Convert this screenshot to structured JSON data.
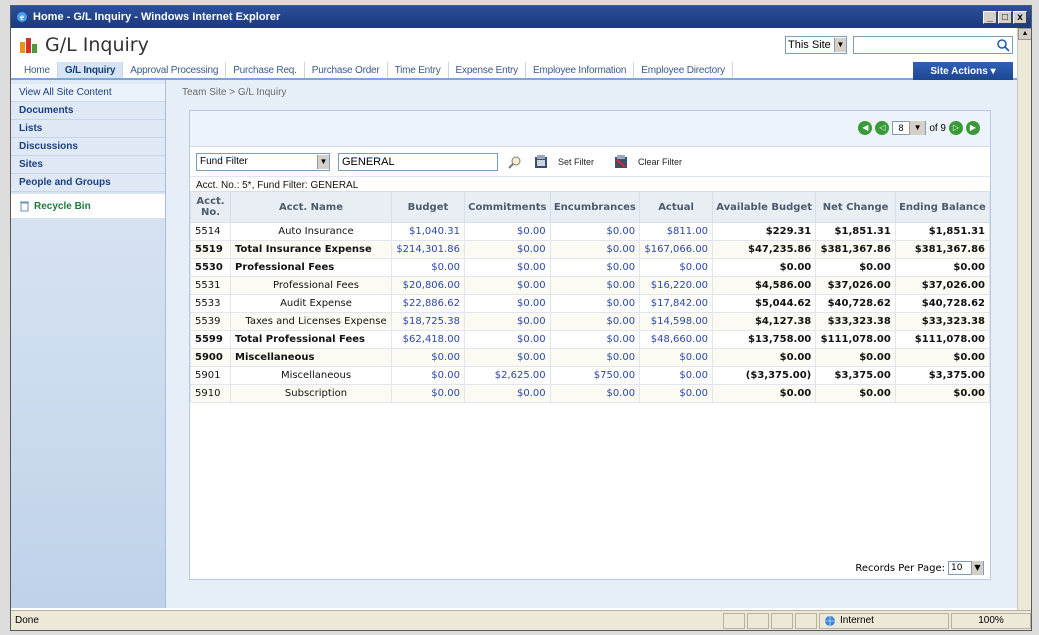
{
  "window": {
    "title": "Home - G/L Inquiry - Windows Internet Explorer",
    "buttons": [
      "_",
      "□",
      "x"
    ]
  },
  "site": {
    "title": "G/L Inquiry",
    "search_scope": "This Site",
    "search_value": ""
  },
  "nav": {
    "tabs": [
      "Home",
      "G/L Inquiry",
      "Approval Processing",
      "Purchase Req.",
      "Purchase Order",
      "Time Entry",
      "Expense Entry",
      "Employee Information",
      "Employee Directory"
    ],
    "site_actions": "Site Actions ▾"
  },
  "leftnav": {
    "items": [
      "View All Site Content",
      "Documents",
      "Lists",
      "Discussions",
      "Sites",
      "People and Groups"
    ],
    "recycle": "Recycle Bin"
  },
  "breadcrumb": "Team Site > G/L Inquiry",
  "pager": {
    "page": "8",
    "of_label": "of 9"
  },
  "filter": {
    "type": "Fund Filter",
    "value": "GENERAL",
    "set_label": "Set Filter",
    "clear_label": "Clear Filter",
    "description": "Acct. No.: 5*, Fund Filter: GENERAL"
  },
  "table": {
    "headers": [
      "Acct. No.",
      "Acct. Name",
      "Budget",
      "Commitments",
      "Encumbrances",
      "Actual",
      "Available Budget",
      "Net Change",
      "Ending Balance"
    ],
    "rows": [
      {
        "acct": "5514",
        "name": "Auto Insurance",
        "total": false,
        "budget": "$1,040.31",
        "commitments": "$0.00",
        "encumbrances": "$0.00",
        "actual": "$811.00",
        "available": "$229.31",
        "net": "$1,851.31",
        "ending": "$1,851.31"
      },
      {
        "acct": "5519",
        "name": "Total Insurance Expense",
        "total": true,
        "budget": "$214,301.86",
        "commitments": "$0.00",
        "encumbrances": "$0.00",
        "actual": "$167,066.00",
        "available": "$47,235.86",
        "net": "$381,367.86",
        "ending": "$381,367.86"
      },
      {
        "acct": "5530",
        "name": "Professional Fees",
        "total": true,
        "budget": "$0.00",
        "commitments": "$0.00",
        "encumbrances": "$0.00",
        "actual": "$0.00",
        "available": "$0.00",
        "net": "$0.00",
        "ending": "$0.00"
      },
      {
        "acct": "5531",
        "name": "Professional Fees",
        "total": false,
        "budget": "$20,806.00",
        "commitments": "$0.00",
        "encumbrances": "$0.00",
        "actual": "$16,220.00",
        "available": "$4,586.00",
        "net": "$37,026.00",
        "ending": "$37,026.00"
      },
      {
        "acct": "5533",
        "name": "Audit Expense",
        "total": false,
        "budget": "$22,886.62",
        "commitments": "$0.00",
        "encumbrances": "$0.00",
        "actual": "$17,842.00",
        "available": "$5,044.62",
        "net": "$40,728.62",
        "ending": "$40,728.62"
      },
      {
        "acct": "5539",
        "name": "Taxes and Licenses Expense",
        "total": false,
        "budget": "$18,725.38",
        "commitments": "$0.00",
        "encumbrances": "$0.00",
        "actual": "$14,598.00",
        "available": "$4,127.38",
        "net": "$33,323.38",
        "ending": "$33,323.38"
      },
      {
        "acct": "5599",
        "name": "Total Professional Fees",
        "total": true,
        "budget": "$62,418.00",
        "commitments": "$0.00",
        "encumbrances": "$0.00",
        "actual": "$48,660.00",
        "available": "$13,758.00",
        "net": "$111,078.00",
        "ending": "$111,078.00"
      },
      {
        "acct": "5900",
        "name": "Miscellaneous",
        "total": true,
        "budget": "$0.00",
        "commitments": "$0.00",
        "encumbrances": "$0.00",
        "actual": "$0.00",
        "available": "$0.00",
        "net": "$0.00",
        "ending": "$0.00"
      },
      {
        "acct": "5901",
        "name": "Miscellaneous",
        "total": false,
        "budget": "$0.00",
        "commitments": "$2,625.00",
        "encumbrances": "$750.00",
        "actual": "$0.00",
        "available": "($3,375.00)",
        "net": "$3,375.00",
        "ending": "$3,375.00"
      },
      {
        "acct": "5910",
        "name": "Subscription",
        "total": false,
        "budget": "$0.00",
        "commitments": "$0.00",
        "encumbrances": "$0.00",
        "actual": "$0.00",
        "available": "$0.00",
        "net": "$0.00",
        "ending": "$0.00"
      }
    ]
  },
  "records": {
    "label": "Records Per Page:",
    "value": "10"
  },
  "status": {
    "text": "Done",
    "zone": "Internet",
    "zoom": "100%"
  },
  "colors": {
    "titlebar": "#1c3a7c",
    "link": "#2b47a8",
    "accent": "#7ea5d8"
  }
}
